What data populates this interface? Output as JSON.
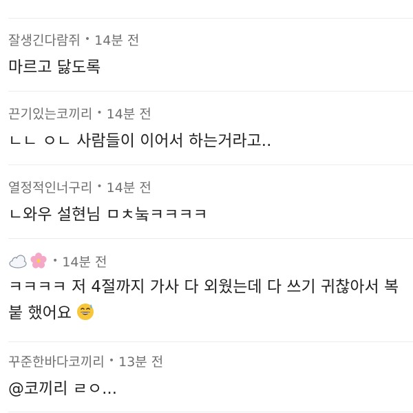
{
  "comments": [
    {
      "author": "잘생긴다람쥐",
      "time": "14분 전",
      "text": "마르고 닳도록"
    },
    {
      "author": "끈기있는코끼리",
      "time": "14분 전",
      "text": "ㄴㄴ ㅇㄴ 사람들이 이어서 하는거라고.."
    },
    {
      "author": "열정적인너구리",
      "time": "14분 전",
      "text": "ㄴ와우 설현님 ㅁㅊ눜ㅋㅋㅋㅋ"
    },
    {
      "author": "☁️🌸",
      "author_icons": [
        "cloud-icon",
        "cherry-blossom-icon"
      ],
      "time": "14분 전",
      "text_line1": "ㅋㅋㅋㅋ 저 4절까지 가사 다 외웠는데 다 쓰기 귀찮아서 복",
      "text_line2": "붙 했어요",
      "text_emoji": "grinning-sweat-icon"
    },
    {
      "author": "꾸준한바다코끼리",
      "time": "13분 전",
      "text": "@코끼리 ㄹㅇ..."
    }
  ],
  "separator": "•"
}
